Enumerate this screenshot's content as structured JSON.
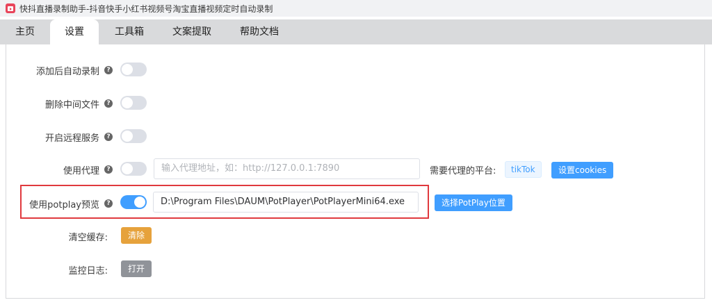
{
  "window": {
    "title": "快抖直播录制助手-抖音快手小红书视频号淘宝直播视频定时自动录制"
  },
  "tabs": [
    {
      "label": "主页",
      "active": false
    },
    {
      "label": "设置",
      "active": true
    },
    {
      "label": "工具箱",
      "active": false
    },
    {
      "label": "文案提取",
      "active": false
    },
    {
      "label": "帮助文档",
      "active": false
    }
  ],
  "settings": {
    "auto_record": {
      "label": "添加后自动录制",
      "enabled": false
    },
    "delete_temp": {
      "label": "删除中间文件",
      "enabled": false
    },
    "remote_service": {
      "label": "开启远程服务",
      "enabled": false
    },
    "proxy": {
      "label": "使用代理",
      "enabled": false,
      "placeholder": "输入代理地址，如：http://127.0.0.1:7890",
      "platform_label": "需要代理的平台:",
      "platform_tag": "tikTok",
      "cookies_button": "设置cookies"
    },
    "potplay": {
      "label": "使用potplay预览",
      "enabled": true,
      "path": "D:\\Program Files\\DAUM\\PotPlayer\\PotPlayerMini64.exe",
      "select_button": "选择PotPlay位置"
    },
    "clear_cache": {
      "label": "清空缓存:",
      "button": "清除"
    },
    "monitor_log": {
      "label": "监控日志:",
      "button": "打开"
    }
  },
  "help_glyph": "?",
  "colors": {
    "accent": "#409eff",
    "warning": "#e6a23c",
    "info": "#909399",
    "highlight_border": "#e0393e"
  }
}
